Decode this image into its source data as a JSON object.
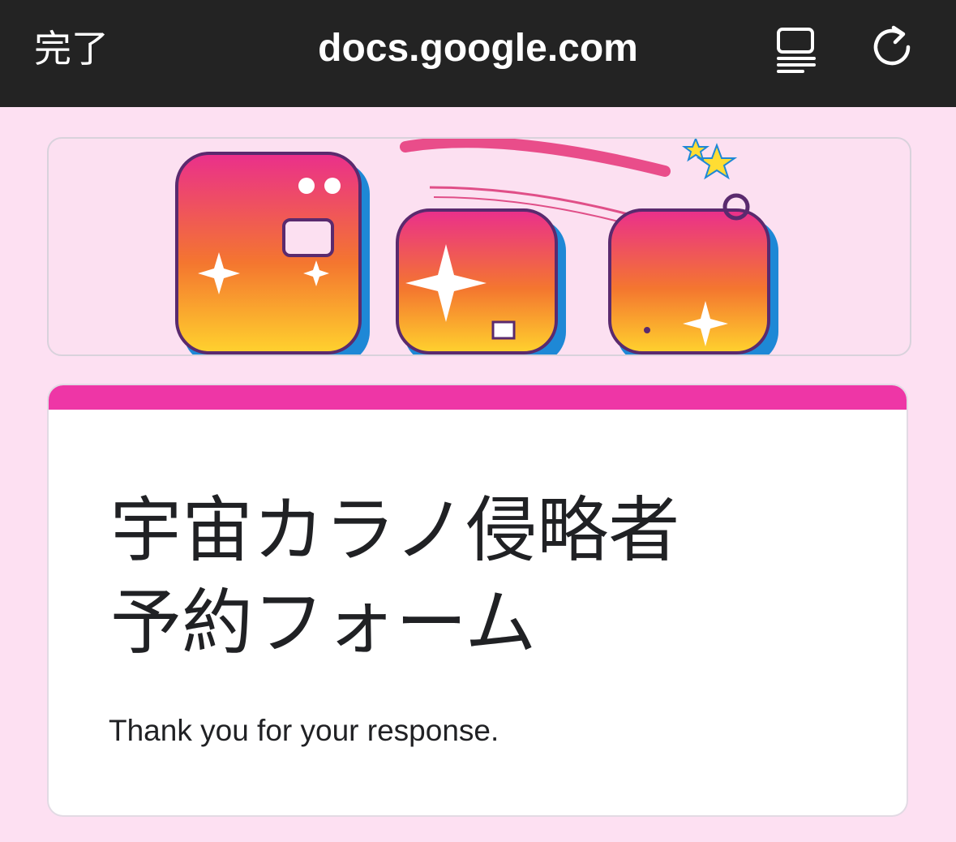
{
  "browser": {
    "done_label": "完了",
    "url": "docs.google.com",
    "reader_icon": "reader-view-icon",
    "reload_icon": "reload-icon"
  },
  "colors": {
    "topbar": "#232323",
    "page_background": "#fde0f2",
    "accent": "#ee36a6",
    "card_background": "#ffffff"
  },
  "form": {
    "title_line1": "宇宙カラノ侵略者",
    "title_line2": "予約フォーム",
    "confirmation": "Thank you for your response."
  }
}
